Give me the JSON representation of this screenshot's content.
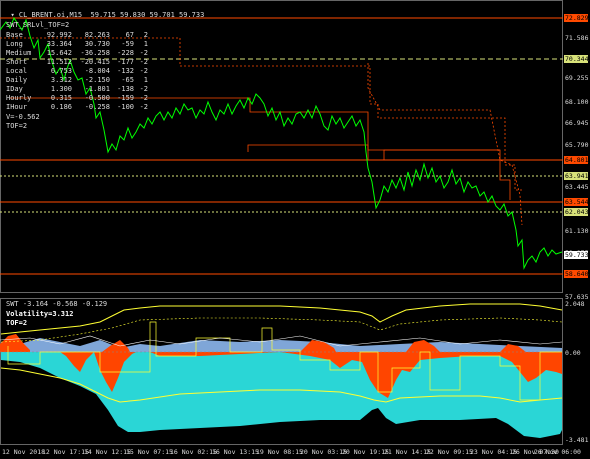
{
  "header": {
    "symbol_line": "CL_BRENT.oi,M15  59.715 59.830 59.701 59.733"
  },
  "main_indicator": {
    "title": "SWT_SRLvl_TOF=2",
    "rows": [
      {
        "name": "Base",
        "v1": "92.992",
        "v2": "82.263",
        "v3": "67",
        "v4": "2"
      },
      {
        "name": "Long",
        "v1": "33.364",
        "v2": "30.730",
        "v3": "-59",
        "v4": "1"
      },
      {
        "name": "Medium",
        "v1": "15.642",
        "v2": "-36.258",
        "v3": "-228",
        "v4": "-2"
      },
      {
        "name": "Short",
        "v1": "11.512",
        "v2": "-20.415",
        "v3": "-177",
        "v4": "-2"
      },
      {
        "name": "Local",
        "v1": "6.753",
        "v2": "-8.004",
        "v3": "-132",
        "v4": "-2"
      },
      {
        "name": "Daily",
        "v1": "3.312",
        "v2": "-2.150",
        "v3": "-65",
        "v4": "1"
      },
      {
        "name": "IDay",
        "v1": "1.300",
        "v2": "-1.801",
        "v3": "-138",
        "v4": "-2"
      },
      {
        "name": "Hourly",
        "v1": "0.315",
        "v2": "-0.500",
        "v3": "-159",
        "v4": "-2"
      },
      {
        "name": "IHour",
        "v1": "0.186",
        "v2": "-0.258",
        "v3": "-100",
        "v4": "-2"
      }
    ],
    "v_line": "V=-0.562",
    "tof_line": "TOF=2"
  },
  "price_axis": {
    "labels": [
      "72.829",
      "71.586",
      "70.344",
      "69.255",
      "68.100",
      "66.945",
      "65.790",
      "64.801",
      "63.941",
      "63.445",
      "62.043",
      "61.130",
      "59.975",
      "58.640",
      "57.635"
    ],
    "tags": [
      {
        "text": "72.829",
        "color": "#ff4a00"
      },
      {
        "text": "70.344",
        "color": "#d8e27a"
      },
      {
        "text": "64.801",
        "color": "#ff4a00"
      },
      {
        "text": "63.941",
        "color": "#d8e27a"
      },
      {
        "text": "63.544",
        "color": "#ff4a00"
      },
      {
        "text": "62.043",
        "color": "#d8e27a"
      },
      {
        "text": "59.733",
        "color": "#ffffff"
      },
      {
        "text": "58.640",
        "color": "#ff4a00"
      }
    ]
  },
  "sub_indicator": {
    "title": "SWT -3.164 -0.568 -0.129",
    "volatility": "Volatility=3.312",
    "tof": "TOF=2",
    "axis_top": "2.048",
    "axis_zero": "0.00",
    "axis_bottom": "-3.481"
  },
  "time_axis": [
    "12 Nov 2018",
    "12 Nov 17:15",
    "14 Nov 12:15",
    "15 Nov 07:15",
    "16 Nov 02:15",
    "16 Nov 13:15",
    "19 Nov 08:15",
    "20 Nov 03:15",
    "20 Nov 19:15",
    "21 Nov 14:15",
    "22 Nov 09:15",
    "23 Nov 04:15",
    "26 Nov 07:30",
    "26 Nov 06:00"
  ],
  "colors": {
    "background": "#000000",
    "price": "#00ff00",
    "resistance": "#ff4a00",
    "support_dashed": "#d8e27a",
    "cyan_fill": "#2ad6d6",
    "orange_fill": "#ff4500",
    "blue_fill": "#7fa6d8",
    "yellow_line": "#ffff33"
  }
}
